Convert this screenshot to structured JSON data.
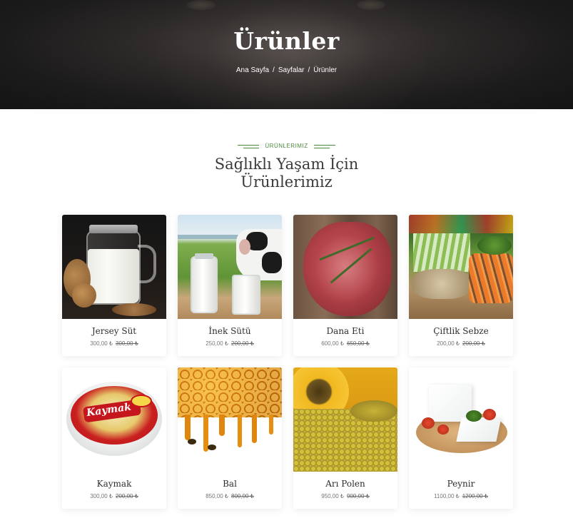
{
  "hero": {
    "title": "Ürünler",
    "breadcrumb": [
      "Ana Sayfa",
      "Sayfalar",
      "Ürünler"
    ],
    "separator": "/"
  },
  "section": {
    "eyebrow": "ÜRÜNLERIMIZ",
    "title_line1": "Sağlıklı Yaşam İçin",
    "title_line2": "Ürünlerimiz",
    "accent_color": "#4c8a3b"
  },
  "products": [
    {
      "name": "Jersey Süt",
      "price": "300,00 ₺",
      "old_price": "300,00 ₺",
      "image": "milk-jar-image"
    },
    {
      "name": "İnek Sütü",
      "price": "250,00 ₺",
      "old_price": "200,00 ₺",
      "image": "cow-milk-image"
    },
    {
      "name": "Dana Eti",
      "price": "600,00 ₺",
      "old_price": "650,00 ₺",
      "image": "beef-steak-image"
    },
    {
      "name": "Çiftlik Sebze",
      "price": "200,00 ₺",
      "old_price": "200,00 ₺",
      "image": "vegetables-image"
    },
    {
      "name": "Kaymak",
      "price": "300,00 ₺",
      "old_price": "200,00 ₺",
      "image": "kaymak-image",
      "brand_text": "Kaymak"
    },
    {
      "name": "Bal",
      "price": "850,00 ₺",
      "old_price": "800,00 ₺",
      "image": "honey-image"
    },
    {
      "name": "Arı Polen",
      "price": "950,00 ₺",
      "old_price": "900,00 ₺",
      "image": "bee-pollen-image"
    },
    {
      "name": "Peynir",
      "price": "1100,00 ₺",
      "old_price": "1200,00 ₺",
      "image": "cheese-image"
    }
  ]
}
